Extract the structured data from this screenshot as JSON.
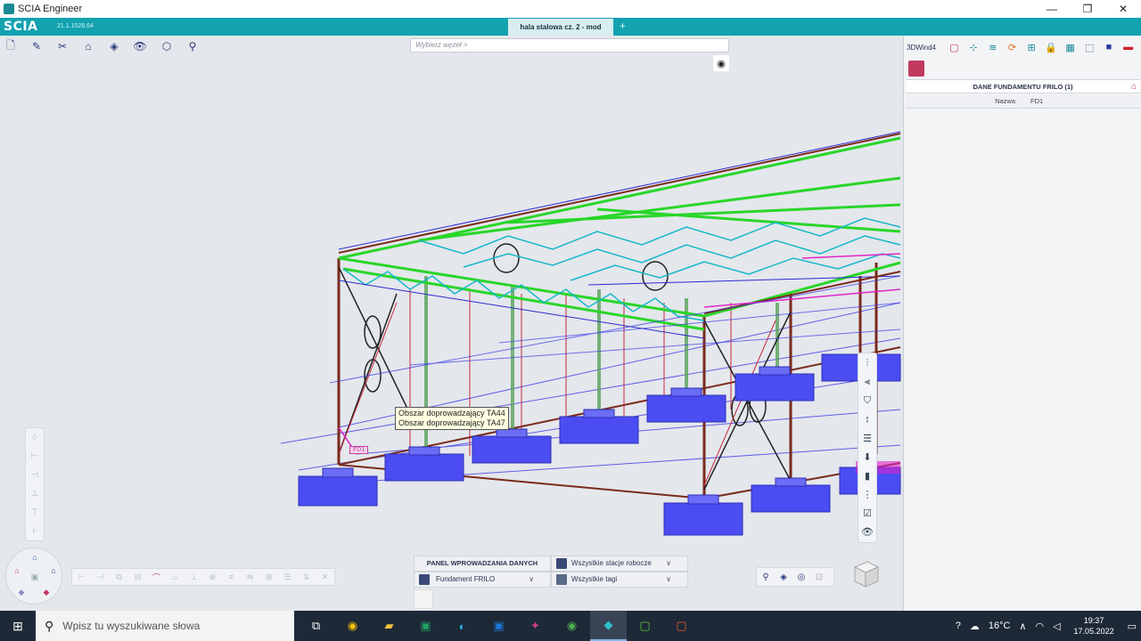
{
  "window": {
    "title": "SCIA Engineer",
    "controls": {
      "minimize": "—",
      "restore": "❐",
      "close": "✕"
    }
  },
  "header": {
    "logo": "SCIA",
    "version": "21.1.1028.64",
    "active_tab": "hala stalowa cz. 2 - mod",
    "add_tab": "+"
  },
  "toolbar": {
    "search_placeholder": "Wybierz węzeł >",
    "preset": "3DWind4"
  },
  "viewport": {
    "tooltip_lines": [
      "Obszar doprowadzający TA44",
      "Obszar doprowadzający TA47"
    ],
    "foundation_label": "FD1"
  },
  "input_panel": {
    "title": "PANEL WPROWADZANIA DANYCH",
    "workstations": "Wszystkie stacje robocze",
    "foundation": "Fundament FRILO",
    "tags": "Wszystkie tagi"
  },
  "properties": {
    "header": "DANE FUNDAMENTU FRILO (1)",
    "rows": [
      {
        "label": "Nazwa",
        "value": "FD1"
      }
    ]
  },
  "taskbar": {
    "search_placeholder": "Wpisz tu wyszukiwane słowa",
    "temperature": "16°C",
    "time": "19:37",
    "date": "17.05.2022"
  },
  "colors": {
    "teal": "#13a2b0",
    "foundation_blue": "#4b4df2",
    "truss_green": "#29d629",
    "column_brown": "#7a2a1a",
    "bracing_magenta": "#e025c9"
  }
}
